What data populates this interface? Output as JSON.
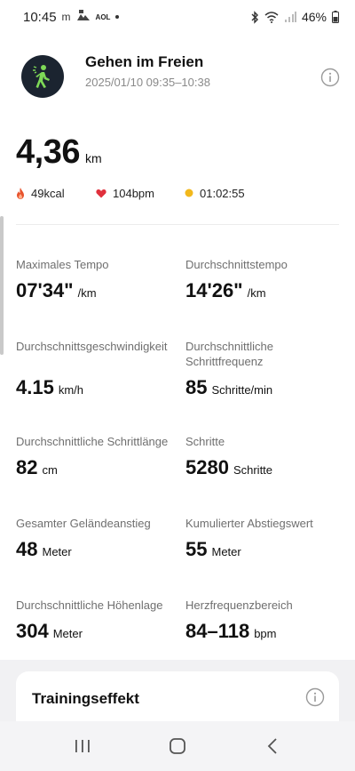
{
  "status_bar": {
    "time": "10:45",
    "carrier_glyph": "m",
    "aol_label": "AOL",
    "battery_percent": "46%"
  },
  "header": {
    "title": "Gehen im Freien",
    "datetime": "2025/01/10 09:35–10:38"
  },
  "summary": {
    "distance_value": "4,36",
    "distance_unit": "km",
    "calories": "49kcal",
    "heart_rate": "104bpm",
    "duration": "01:02:55"
  },
  "metrics": [
    {
      "label": "Maximales Tempo",
      "value": "07'34\"",
      "unit": "/km"
    },
    {
      "label": "Durchschnittstempo",
      "value": "14'26\"",
      "unit": "/km"
    },
    {
      "label": "Durchschnittsgeschwindigkeit",
      "value": "4.15",
      "unit": "km/h"
    },
    {
      "label": "Durchschnittliche Schrittfrequenz",
      "value": "85",
      "unit": "Schritte/min"
    },
    {
      "label": "Durchschnittliche Schrittlänge",
      "value": "82",
      "unit": "cm"
    },
    {
      "label": "Schritte",
      "value": "5280",
      "unit": "Schritte"
    },
    {
      "label": "Gesamter Geländeanstieg",
      "value": "48",
      "unit": "Meter"
    },
    {
      "label": "Kumulierter Abstiegswert",
      "value": "55",
      "unit": "Meter"
    },
    {
      "label": "Durchschnittliche Höhenlage",
      "value": "304",
      "unit": "Meter"
    },
    {
      "label": "Herzfrequenzbereich",
      "value": "84–118",
      "unit": "bpm"
    }
  ],
  "training_card": {
    "title": "Trainingseffekt"
  },
  "colors": {
    "calorie_icon": "#e8542e",
    "heart_icon": "#e0303c",
    "duration_icon": "#f2b81c",
    "activity_figure": "#7ed957",
    "activity_bg": "#1b2430"
  },
  "icons": {
    "activity": "walking-person-icon",
    "calories": "flame-icon",
    "heart": "heart-icon",
    "duration": "dot-icon",
    "info": "info-icon"
  }
}
